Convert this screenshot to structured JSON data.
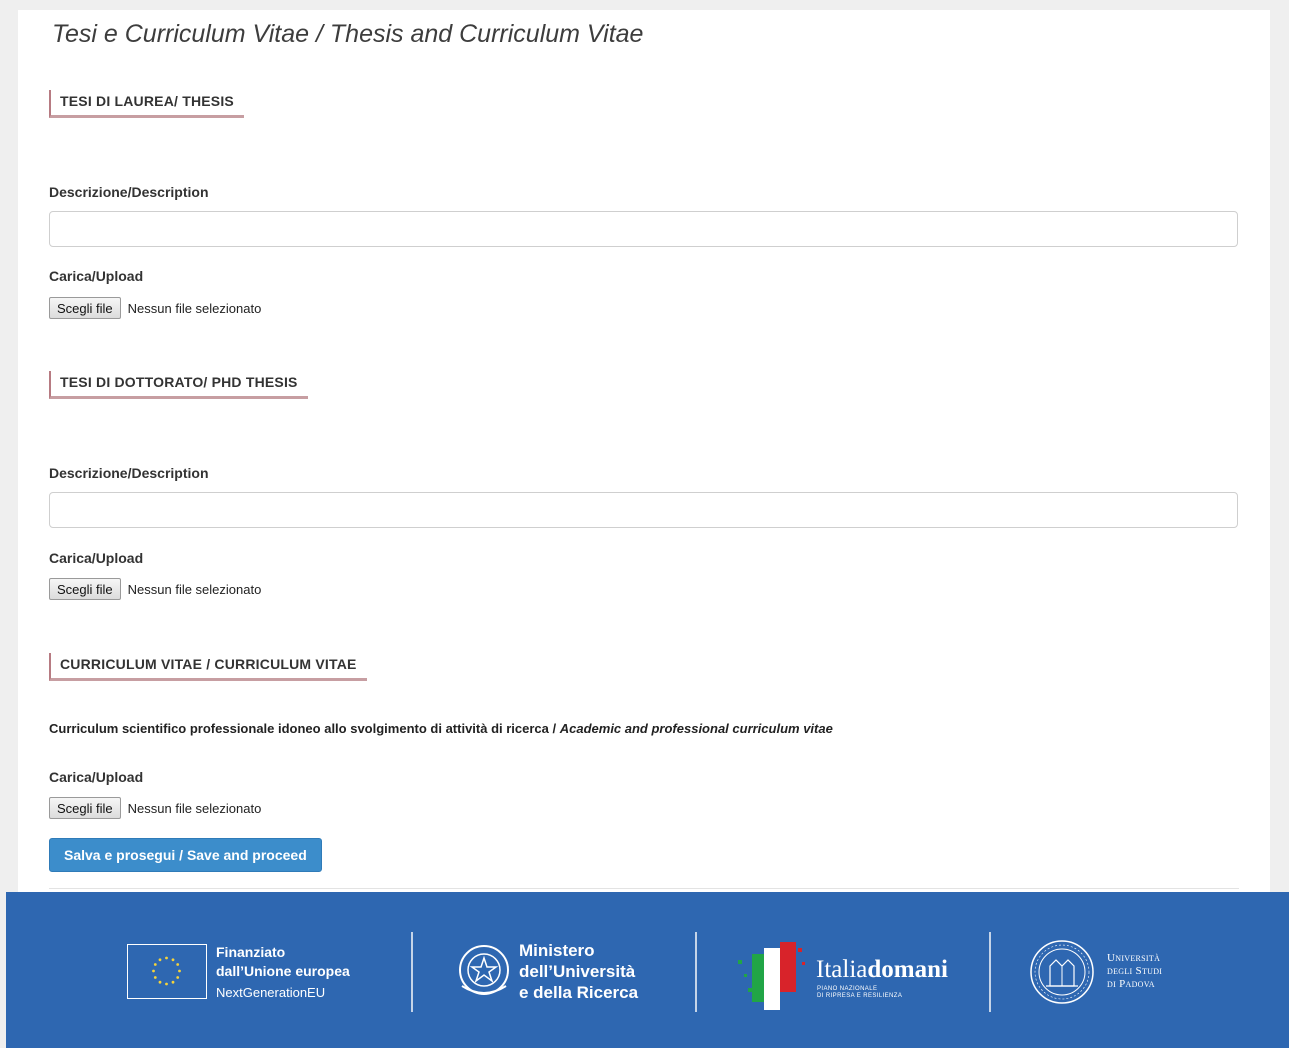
{
  "page": {
    "title": "Tesi e Curriculum Vitae / Thesis and Curriculum Vitae"
  },
  "sections": [
    {
      "heading": "TESI DI LAUREA/ THESIS",
      "description_label": "Descrizione/Description",
      "description_value": "",
      "upload_label": "Carica/Upload",
      "file_button": "Scegli file",
      "file_status": "Nessun file selezionato"
    },
    {
      "heading": "TESI DI DOTTORATO/ PHD THESIS",
      "description_label": "Descrizione/Description",
      "description_value": "",
      "upload_label": "Carica/Upload",
      "file_button": "Scegli file",
      "file_status": "Nessun file selezionato"
    },
    {
      "heading": "CURRICULUM VITAE / CURRICULUM VITAE",
      "text_it": "Curriculum scientifico professionale idoneo allo svolgimento di attività di ricerca / ",
      "text_en": "Academic and professional curriculum vitae",
      "upload_label": "Carica/Upload",
      "file_button": "Scegli file",
      "file_status": "Nessun file selezionato"
    }
  ],
  "actions": {
    "save_label": "Salva e prosegui / Save and proceed"
  },
  "footer": {
    "eu_line1": "Finanziato",
    "eu_line2": "dall’Unione europea",
    "eu_line3": "NextGenerationEU",
    "mur_line1": "Ministero",
    "mur_line2": "dell’Università",
    "mur_line3": "e della Ricerca",
    "italia_a": "Italia",
    "italia_b": "domani",
    "italia_sub1": "PIANO NAZIONALE",
    "italia_sub2": "DI RIPRESA E RESILIENZA",
    "uni_line1": "Università",
    "uni_line2": "degli Studi",
    "uni_line3": "di Padova",
    "colors": {
      "background": "#2e67b1",
      "eu_star": "#f5d33a",
      "italy_green": "#21a546",
      "italy_red": "#d8232a"
    }
  },
  "colors": {
    "section_accent": "#c79ea2",
    "primary_button": "#3c8dcb"
  }
}
